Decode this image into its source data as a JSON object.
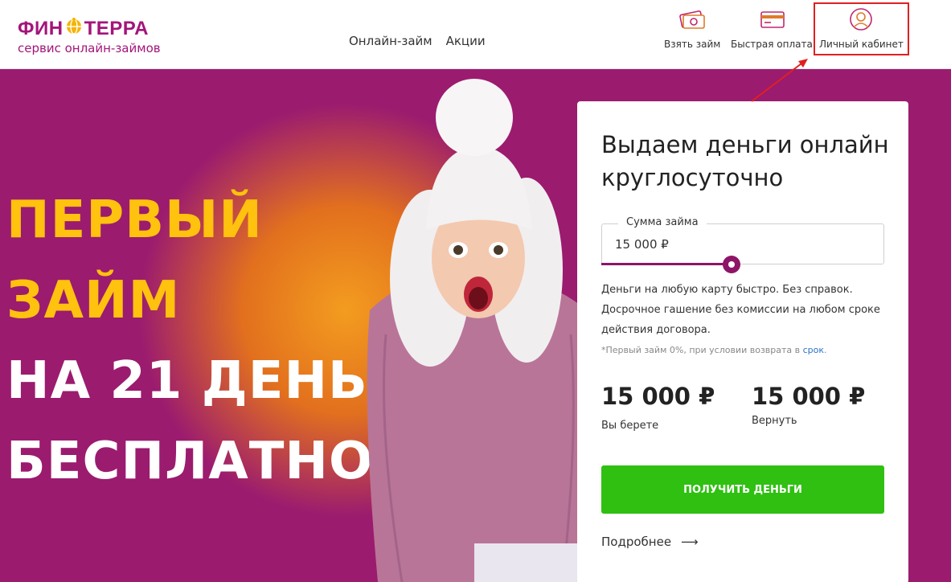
{
  "header": {
    "logo_left": "ФИН",
    "logo_right": "ТЕРРА",
    "logo_sub": "сервис онлайн-займов",
    "nav": [
      "Онлайн-займ",
      "Акции"
    ],
    "actions": {
      "take_loan": "Взять займ",
      "quick_pay": "Быстрая оплата",
      "cabinet": "Личный кабинет"
    }
  },
  "hero": {
    "line1": "ПЕРВЫЙ",
    "line2": "ЗАЙМ",
    "line3": "НА 21 ДЕНЬ",
    "line4": "БЕСПЛАТНО",
    "star": "*"
  },
  "card": {
    "title": "Выдаем деньги онлайн круглосуточно",
    "amount_label": "Сумма займа",
    "amount_value": "15 000 ₽",
    "slider_fraction": 0.46,
    "desc": "Деньги на любую карту быстро. Без справок. Досрочное гашение без комиссии на любом сроке действия договора.",
    "note_text": "*Первый займ 0%, при условии возврата в ",
    "note_link": "срок",
    "note_end": ".",
    "give_value": "15 000 ₽",
    "give_caption": "Вы берете",
    "return_value": "15 000 ₽",
    "return_caption": "Вернуть",
    "cta": "ПОЛУЧИТЬ ДЕНЬГИ",
    "more": "Подробнее",
    "more_arrow": "⟶"
  },
  "colors": {
    "brand": "#a3157a",
    "hero_bg": "#9b1b6f",
    "accent_yellow": "#ffc20e",
    "cta_green": "#2fc012",
    "highlight_red": "#e02020"
  }
}
